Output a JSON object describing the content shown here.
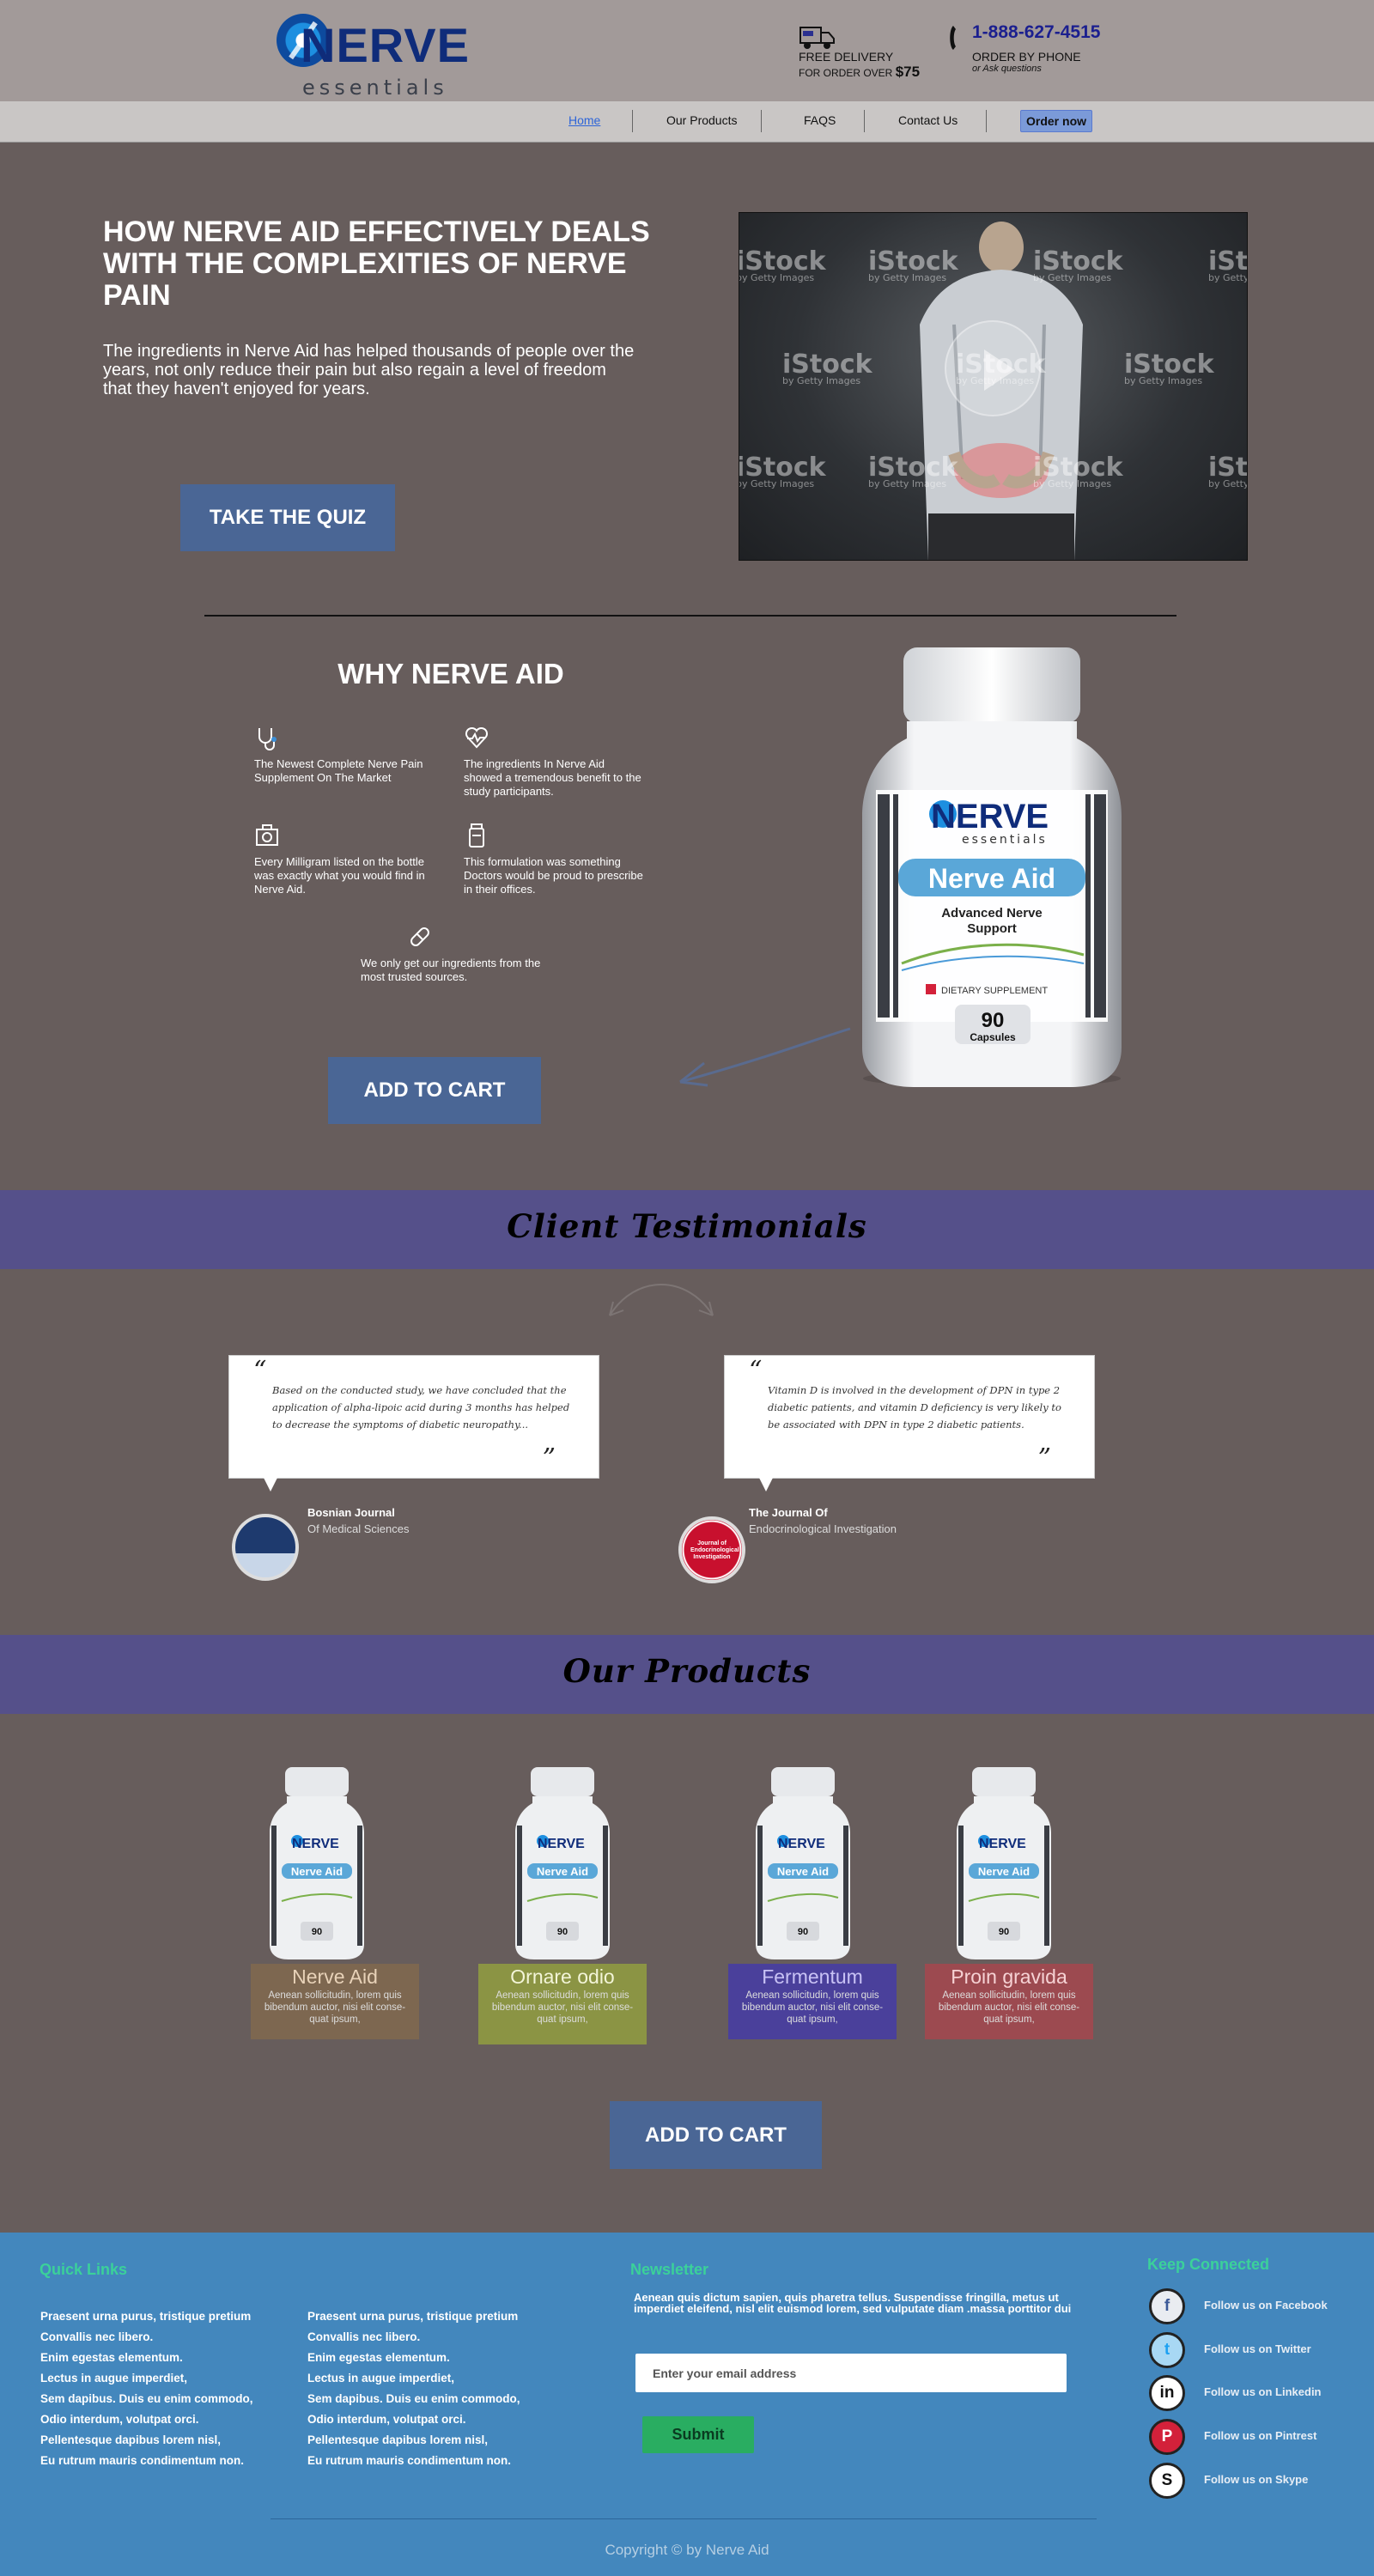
{
  "header": {
    "logo_word": "NERVE",
    "logo_sub": "essentials",
    "delivery_line1": "FREE DELIVERY",
    "delivery_line2": "FOR ORDER OVER",
    "delivery_amount": "$75",
    "phone_number": "1-888-627-4515",
    "phone_line1": "ORDER BY PHONE",
    "phone_line2": "or Ask questions"
  },
  "nav": {
    "items": [
      "Home",
      "Our Products",
      "FAQS",
      "Contact Us"
    ],
    "cta": "Order now"
  },
  "hero": {
    "title": "HOW NERVE AID EFFECTIVELY DEALS WITH THE COMPLEXITIES OF NERVE PAIN",
    "text": "The ingredients in Nerve Aid has helped thousands of people over the years, not only reduce their pain but also regain a level of freedom that they haven't enjoyed for years.",
    "quiz_button": "TAKE THE QUIZ",
    "watermark": "iStock",
    "watermark_sub": "by Getty Images"
  },
  "why": {
    "title": "WHY NERVE AID",
    "features": [
      {
        "text": "The Newest Complete Nerve Pain Supplement On The Market",
        "icon": "stethoscope-icon"
      },
      {
        "text": "The ingredients In Nerve Aid showed a tremendous benefit to the study participants.",
        "icon": "heartbeat-icon"
      },
      {
        "text": "Every Milligram listed on the bottle was exactly what you would find in Nerve Aid.",
        "icon": "medkit-icon"
      },
      {
        "text": "This formulation was something Doctors would be proud to prescribe in their offices.",
        "icon": "bottle-icon"
      },
      {
        "text": "We only get our ingredients from the most trusted sources.",
        "icon": "pill-icon"
      }
    ],
    "cart_button": "ADD TO CART"
  },
  "bottle": {
    "brand": "NERVE",
    "brand_sub": "essentials",
    "product": "Nerve Aid",
    "subtitle": "Advanced Nerve Support",
    "badge": "DIETARY SUPPLEMENT",
    "count": "90",
    "count_label": "Capsules"
  },
  "testimonials": {
    "title": "Client Testimonials",
    "items": [
      {
        "quote": "Based on the conducted study, we have concluded that the application of alpha-lipoic acid during 3 months has helped to decrease the symptoms of diabetic neuropathy...",
        "source": "Bosnian Journal",
        "source_sub": "Of Medical Sciences"
      },
      {
        "quote": "Vitamin D is involved in the development of DPN in type 2 diabetic patients, and vitamin D deficiency is very likely to be associated with DPN in type 2 diabetic patients.",
        "source": "The Journal Of",
        "source_sub": "Endocrinological Investigation",
        "avatar_text": "Journal of Endocrinological Investigation"
      }
    ]
  },
  "products": {
    "title": "Our Products",
    "items": [
      {
        "name": "Nerve Aid",
        "desc": "Aenean sollicitudin, lorem quis bibendum auctor, nisi elit conse-quat ipsum,",
        "bg": "#7d6750",
        "name_color": "#e8d2b8"
      },
      {
        "name": "Ornare odio",
        "desc": "Aenean sollicitudin, lorem quis bibendum auctor, nisi elit conse-quat ipsum,",
        "bg": "#8b9444",
        "name_color": "#f3f5d8"
      },
      {
        "name": "Fermentum",
        "desc": "Aenean sollicitudin, lorem quis bibendum auctor, nisi elit conse-quat ipsum,",
        "bg": "#4a409b",
        "name_color": "#c8c2f5"
      },
      {
        "name": "Proin gravida",
        "desc": "Aenean sollicitudin, lorem quis bibendum auctor, nisi elit conse-quat ipsum,",
        "bg": "#9c4a50",
        "name_color": "#f6d2d4"
      }
    ],
    "cart_button": "ADD TO CART"
  },
  "footer": {
    "quick_links_title": "Quick Links",
    "links": [
      "Praesent urna purus, tristique pretium",
      "Convallis nec libero.",
      "Enim egestas elementum.",
      "Lectus in augue imperdiet,",
      "Sem dapibus. Duis eu enim commodo,",
      "Odio interdum, volutpat orci.",
      "Pellentesque dapibus lorem nisl,",
      "Eu rutrum mauris condimentum non."
    ],
    "newsletter_title": "Newsletter",
    "newsletter_text": "Aenean quis dictum sapien, quis pharetra tellus. Suspendisse fringilla, metus ut imperdiet eleifend, nisl elit euismod lorem, sed vulputate diam .massa porttitor dui",
    "email_placeholder": "Enter your email address",
    "submit": "Submit",
    "connected_title": "Keep Connected",
    "social": [
      {
        "label": "Follow us on Facebook",
        "icon": "facebook-icon",
        "glyph": "f",
        "bg": "#e9ecf1",
        "fg": "#3b5998"
      },
      {
        "label": "Follow us on Twitter",
        "icon": "twitter-icon",
        "glyph": "t",
        "bg": "#a8d8f4",
        "fg": "#1da1f2"
      },
      {
        "label": "Follow us on Linkedin",
        "icon": "linkedin-icon",
        "glyph": "in",
        "bg": "#ffffff",
        "fg": "#111111"
      },
      {
        "label": "Follow us on Pintrest",
        "icon": "pinterest-icon",
        "glyph": "P",
        "bg": "#d3213a",
        "fg": "#ffffff"
      },
      {
        "label": "Follow us on Skype",
        "icon": "skype-icon",
        "glyph": "S",
        "bg": "#ffffff",
        "fg": "#111111"
      }
    ],
    "copyright": "Copyright © by Nerve Aid"
  },
  "colors": {
    "header_bg": "#a29a99",
    "page_bg": "#675d5c",
    "band_bg": "#55508a",
    "button_bg": "#4a6695",
    "footer_bg": "#4387bd",
    "footer_heading": "#3bd19a"
  }
}
